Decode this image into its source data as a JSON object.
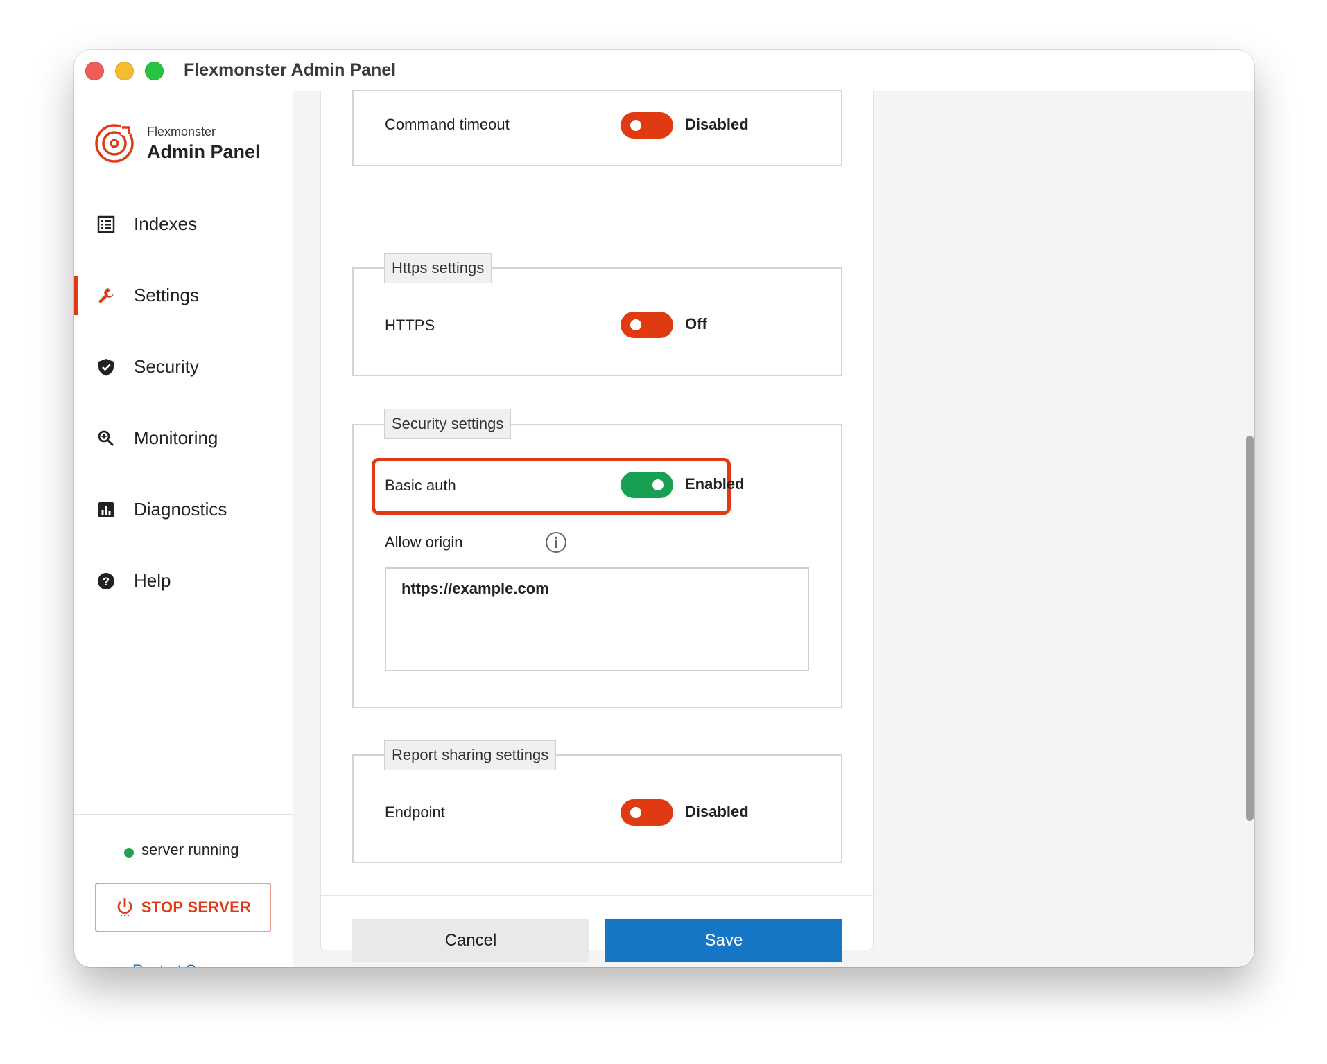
{
  "window": {
    "title": "Flexmonster Admin Panel"
  },
  "sidebar": {
    "logo_small": "Flexmonster",
    "logo_big": "Admin Panel",
    "items": [
      {
        "label": "Indexes",
        "icon": "list-icon"
      },
      {
        "label": "Settings",
        "icon": "wrench-icon",
        "active": true
      },
      {
        "label": "Security",
        "icon": "shield-icon"
      },
      {
        "label": "Monitoring",
        "icon": "search-icon"
      },
      {
        "label": "Diagnostics",
        "icon": "chart-icon"
      },
      {
        "label": "Help",
        "icon": "help-icon"
      }
    ],
    "status_text": "server running",
    "stop_button": "STOP SERVER",
    "restart_link": "Restart Server"
  },
  "main": {
    "command_timeout": {
      "label": "Command timeout",
      "state": "Disabled",
      "on": false
    },
    "https_section": {
      "legend": "Https settings",
      "label": "HTTPS",
      "state": "Off",
      "on": false
    },
    "security_section": {
      "legend": "Security settings",
      "basic_auth": {
        "label": "Basic auth",
        "state": "Enabled",
        "on": true
      },
      "allow_origin_label": "Allow origin",
      "allow_origin_value": "https://example.com"
    },
    "report_section": {
      "legend": "Report sharing settings",
      "label": "Endpoint",
      "state": "Disabled",
      "on": false
    },
    "cancel_label": "Cancel",
    "save_label": "Save"
  },
  "colors": {
    "accent": "#df3a16",
    "toggle_on": "#17a052",
    "primary_button": "#1677c7",
    "status_running": "#1ea44f"
  }
}
